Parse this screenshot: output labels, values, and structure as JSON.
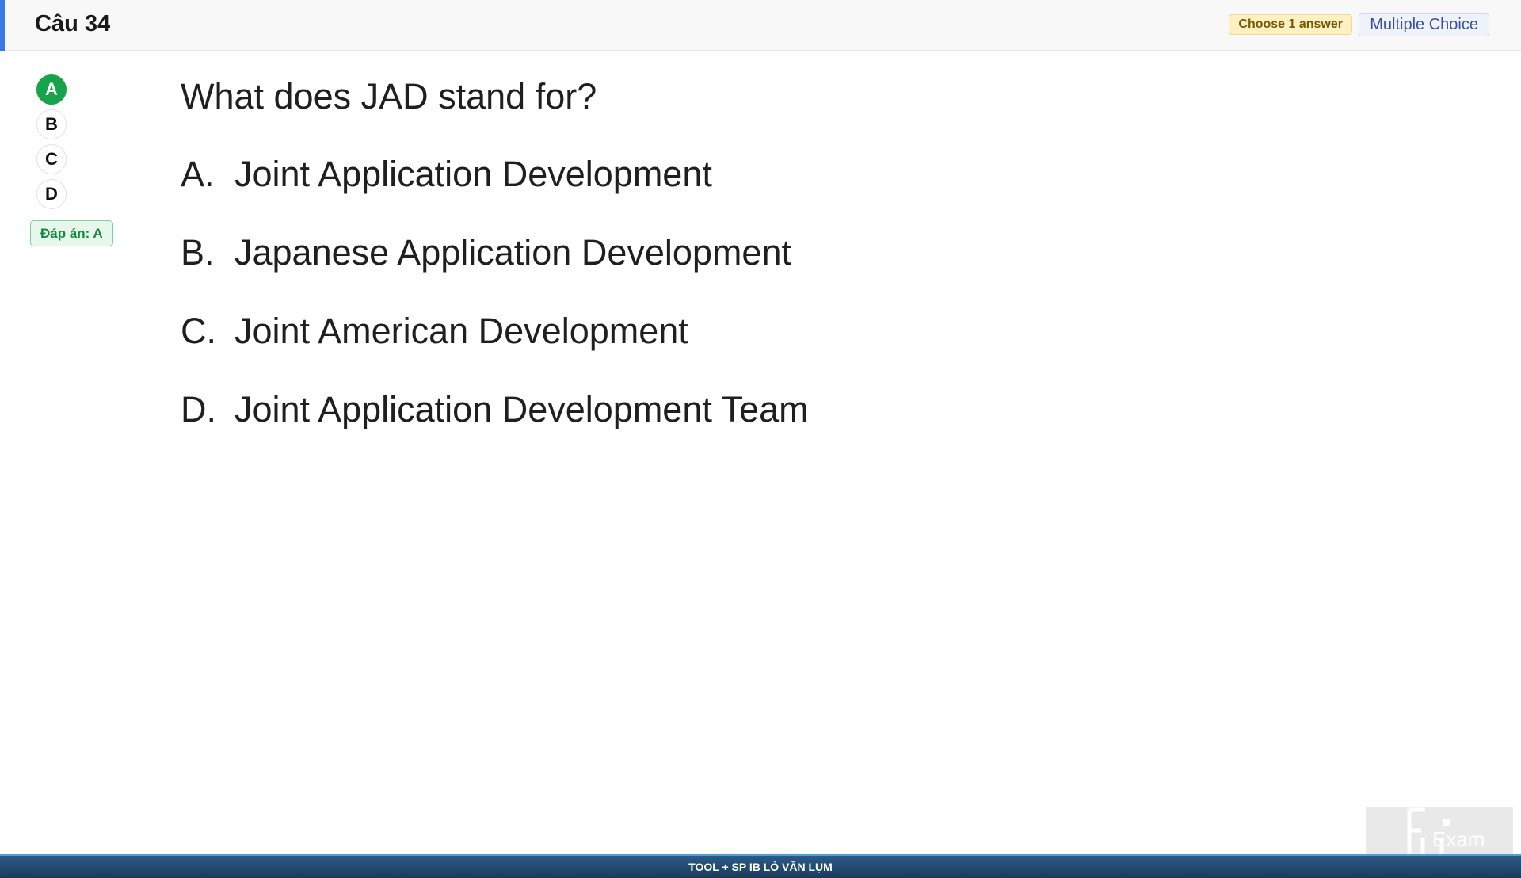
{
  "header": {
    "question_number": "Câu 34",
    "badge_choose": "Choose 1 answer",
    "badge_type": "Multiple Choice"
  },
  "answer_panel": {
    "choices": [
      "A",
      "B",
      "C",
      "D"
    ],
    "selected": "A",
    "result_label": "Đáp án: A"
  },
  "question": {
    "text": "What does JAD stand for?",
    "options": [
      {
        "letter": "A.",
        "text": "Joint Application Development"
      },
      {
        "letter": "B.",
        "text": "Japanese Application Development"
      },
      {
        "letter": "C.",
        "text": "Joint American Development"
      },
      {
        "letter": "D.",
        "text": "Joint Application Development Team"
      }
    ]
  },
  "watermark": {
    "text": "Exam"
  },
  "footer": {
    "text": "TOOL + SP IB LÒ VĂN LỤM"
  },
  "colors": {
    "header_accent": "#3b78e7",
    "selected_answer": "#16a34a",
    "footer_bg": "#1c3b5c"
  }
}
